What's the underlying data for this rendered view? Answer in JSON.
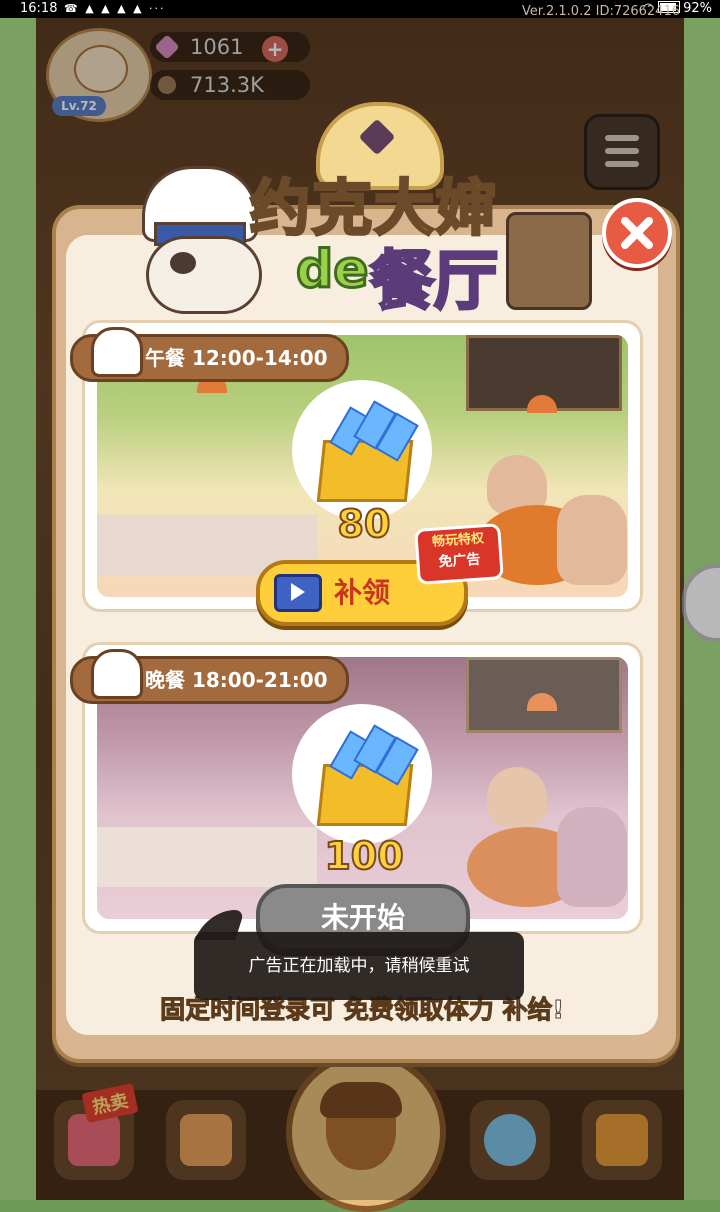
{
  "status_bar": {
    "time": "16:18",
    "icons": "☎ ▲ ▲ ▲ ▲ ···",
    "battery": "92%"
  },
  "hud": {
    "version": "Ver.2.1.0.2 ID:72662416",
    "gems": "1061",
    "stamina": "713.3K",
    "level": "Lv.72"
  },
  "popup": {
    "title_line1": "约克大婶",
    "title_de": "de",
    "title_line2": "餐厅",
    "meals": [
      {
        "label": "午餐 12:00-14:00",
        "amount": "80",
        "button": "补领",
        "badge": [
          "畅玩特权",
          "免广告"
        ]
      },
      {
        "label": "晚餐 18:00-21:00",
        "amount": "100",
        "button": "未开始"
      }
    ],
    "footer_prefix": "固定时间登录可 ",
    "footer_highlight": "免费领取体力",
    "footer_suffix": " 补给!"
  },
  "toast": "广告正在加载中，请稍候重试",
  "bottom_nav": {
    "hot_label": "热卖"
  },
  "colors": {
    "accent_yellow": "#ffcf3b",
    "close_red": "#e75a44",
    "panel_bg": "#d8b58e",
    "claim_text": "#c8351f"
  }
}
